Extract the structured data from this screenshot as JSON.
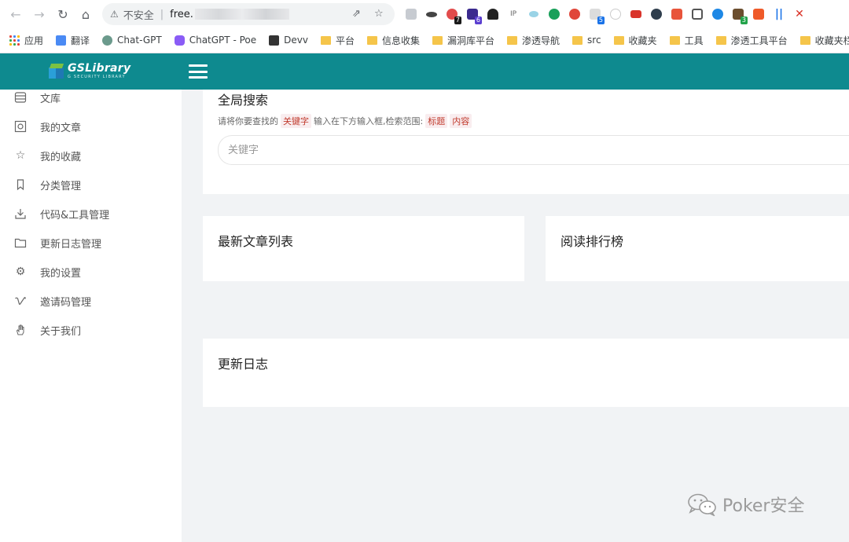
{
  "browser": {
    "address": {
      "security_label": "不安全",
      "url_visible": "free."
    },
    "extensions_badges": [
      "7",
      "6",
      "5",
      "3"
    ],
    "bookmarks": [
      {
        "label": "应用",
        "icon": "apps-grid-icon"
      },
      {
        "label": "翻译",
        "icon": "translate-icon"
      },
      {
        "label": "Chat-GPT",
        "icon": "openai-icon"
      },
      {
        "label": "ChatGPT - Poe",
        "icon": "poe-icon"
      },
      {
        "label": "Devv",
        "icon": "cube-icon"
      },
      {
        "label": "平台",
        "icon": "folder-icon"
      },
      {
        "label": "信息收集",
        "icon": "folder-icon"
      },
      {
        "label": "漏洞库平台",
        "icon": "folder-icon"
      },
      {
        "label": "渗透导航",
        "icon": "folder-icon"
      },
      {
        "label": "src",
        "icon": "folder-icon"
      },
      {
        "label": "收藏夹",
        "icon": "folder-icon"
      },
      {
        "label": "工具",
        "icon": "folder-icon"
      },
      {
        "label": "渗透工具平台",
        "icon": "folder-icon"
      },
      {
        "label": "收藏夹栏",
        "icon": "folder-icon"
      }
    ]
  },
  "header": {
    "logo_title": "GSLibrary",
    "logo_subtitle": "G SECURITY LIBRARY",
    "accent_color": "#0e8a8f"
  },
  "sidebar": {
    "items": [
      {
        "label": "文库",
        "icon": "database-icon"
      },
      {
        "label": "我的文章",
        "icon": "photo-frame-icon"
      },
      {
        "label": "我的收藏",
        "icon": "star-icon"
      },
      {
        "label": "分类管理",
        "icon": "bookmark-icon"
      },
      {
        "label": "代码&工具管理",
        "icon": "download-icon"
      },
      {
        "label": "更新日志管理",
        "icon": "folder-icon"
      },
      {
        "label": "我的设置",
        "icon": "gear-icon"
      },
      {
        "label": "邀请码管理",
        "icon": "vimeo-icon"
      },
      {
        "label": "关于我们",
        "icon": "hand-icon"
      }
    ]
  },
  "search_panel": {
    "title": "全局搜索",
    "hint_prefix": "请将你要查找的",
    "hint_keyword_tag": "关键字",
    "hint_middle": "输入在下方输入框,检索范围:",
    "hint_scope_tags": [
      "标题",
      "内容"
    ],
    "input_placeholder": "关键字"
  },
  "latest_articles": {
    "title": "最新文章列表"
  },
  "reading_rank": {
    "title": "阅读排行榜"
  },
  "changelog": {
    "title": "更新日志"
  },
  "watermark": {
    "text": "Poker安全"
  }
}
